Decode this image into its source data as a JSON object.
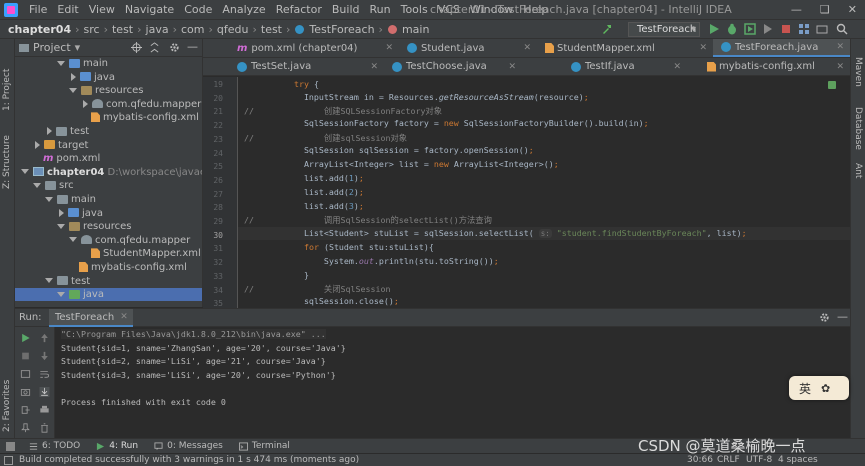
{
  "menu": {
    "items": [
      "File",
      "Edit",
      "View",
      "Navigate",
      "Code",
      "Analyze",
      "Refactor",
      "Build",
      "Run",
      "Tools",
      "VCS",
      "Window",
      "Help"
    ],
    "window_title": "chapter01 - TestForeach.java [chapter04] - IntelliJ IDEA"
  },
  "breadcrumb": [
    "chapter04",
    "src",
    "test",
    "java",
    "com",
    "qfedu",
    "test",
    "TestForeach",
    "main"
  ],
  "run_config": "TestForeach",
  "project": {
    "title": "Project",
    "tree": [
      {
        "label": "main",
        "indent": 2,
        "arrow": "d",
        "icon": "f-blue"
      },
      {
        "label": "java",
        "indent": 3,
        "arrow": "r",
        "icon": "f-blue"
      },
      {
        "label": "resources",
        "indent": 3,
        "arrow": "d",
        "icon": "f-res"
      },
      {
        "label": "com.qfedu.mapper",
        "indent": 4,
        "arrow": "r",
        "icon": "f-pkg"
      },
      {
        "label": "mybatis-config.xml",
        "indent": 4,
        "arrow": "",
        "icon": "xml"
      },
      {
        "label": "test",
        "indent": 1,
        "arrow": "r",
        "icon": "f-gray"
      },
      {
        "label": "target",
        "indent": 0,
        "arrow": "r",
        "icon": "f-orange"
      },
      {
        "label": "pom.xml",
        "indent": 0,
        "arrow": "",
        "icon": "pom"
      },
      {
        "label": "chapter04",
        "extra": "D:\\workspace\\javaee\\chapter",
        "indent": -1,
        "arrow": "d",
        "icon": "mod",
        "bold": true
      },
      {
        "label": "src",
        "indent": 0,
        "arrow": "d",
        "icon": "f-gray"
      },
      {
        "label": "main",
        "indent": 1,
        "arrow": "d",
        "icon": "f-gray"
      },
      {
        "label": "java",
        "indent": 2,
        "arrow": "r",
        "icon": "f-blue"
      },
      {
        "label": "resources",
        "indent": 2,
        "arrow": "d",
        "icon": "f-res"
      },
      {
        "label": "com.qfedu.mapper",
        "indent": 3,
        "arrow": "d",
        "icon": "f-pkg"
      },
      {
        "label": "StudentMapper.xml",
        "indent": 4,
        "arrow": "",
        "icon": "xml"
      },
      {
        "label": "mybatis-config.xml",
        "indent": 3,
        "arrow": "",
        "icon": "xml"
      },
      {
        "label": "test",
        "indent": 1,
        "arrow": "d",
        "icon": "f-gray"
      },
      {
        "label": "java",
        "indent": 2,
        "arrow": "d",
        "icon": "f-green",
        "selected": true
      }
    ]
  },
  "tabs_row1": [
    {
      "label": "pom.xml (chapter04)",
      "icon": "m"
    },
    {
      "label": "Student.java",
      "icon": "c"
    },
    {
      "label": "StudentMapper.xml",
      "icon": "x"
    },
    {
      "label": "TestForeach.java",
      "icon": "c",
      "active": true
    }
  ],
  "tabs_row2": [
    {
      "label": "TestSet.java",
      "icon": "c"
    },
    {
      "label": "TestChoose.java",
      "icon": "c"
    },
    {
      "label": "TestIf.java",
      "icon": "c"
    },
    {
      "label": "mybatis-config.xml",
      "icon": "x"
    }
  ],
  "code": {
    "line_numbers": [
      "19",
      "20",
      "21",
      "22",
      "23",
      "24",
      "25",
      "26",
      "27",
      "28",
      "29",
      "30",
      "31",
      "32",
      "33",
      "34",
      "35"
    ],
    "current_line": "30"
  },
  "run": {
    "label": "Run:",
    "tab": "TestForeach",
    "console": [
      "\"C:\\Program Files\\Java\\jdk1.8.0_212\\bin\\java.exe\" ...",
      "Student{sid=1, sname='ZhangSan', age='20', course='Java'}",
      "Student{sid=2, sname='LiSi', age='21', course='Java'}",
      "Student{sid=3, sname='LiSi', age='20', course='Python'}",
      "",
      "Process finished with exit code 0"
    ]
  },
  "bottom_tabs": [
    "6: TODO",
    "4: Run",
    "0: Messages",
    "Terminal"
  ],
  "status": {
    "message": "Build completed successfully with 3 warnings in 1 s 474 ms (moments ago)",
    "position": "30:66",
    "line_sep": "CRLF",
    "encoding": "UTF-8",
    "indent": "4 spaces"
  },
  "side_labels": {
    "project": "1: Project",
    "structure": "Z: Structure",
    "favorites": "2: Favorites",
    "maven": "Maven",
    "database": "Database",
    "ant": "Ant"
  },
  "ime": "英",
  "watermark": "CSDN @莫道桑榆晚一点"
}
